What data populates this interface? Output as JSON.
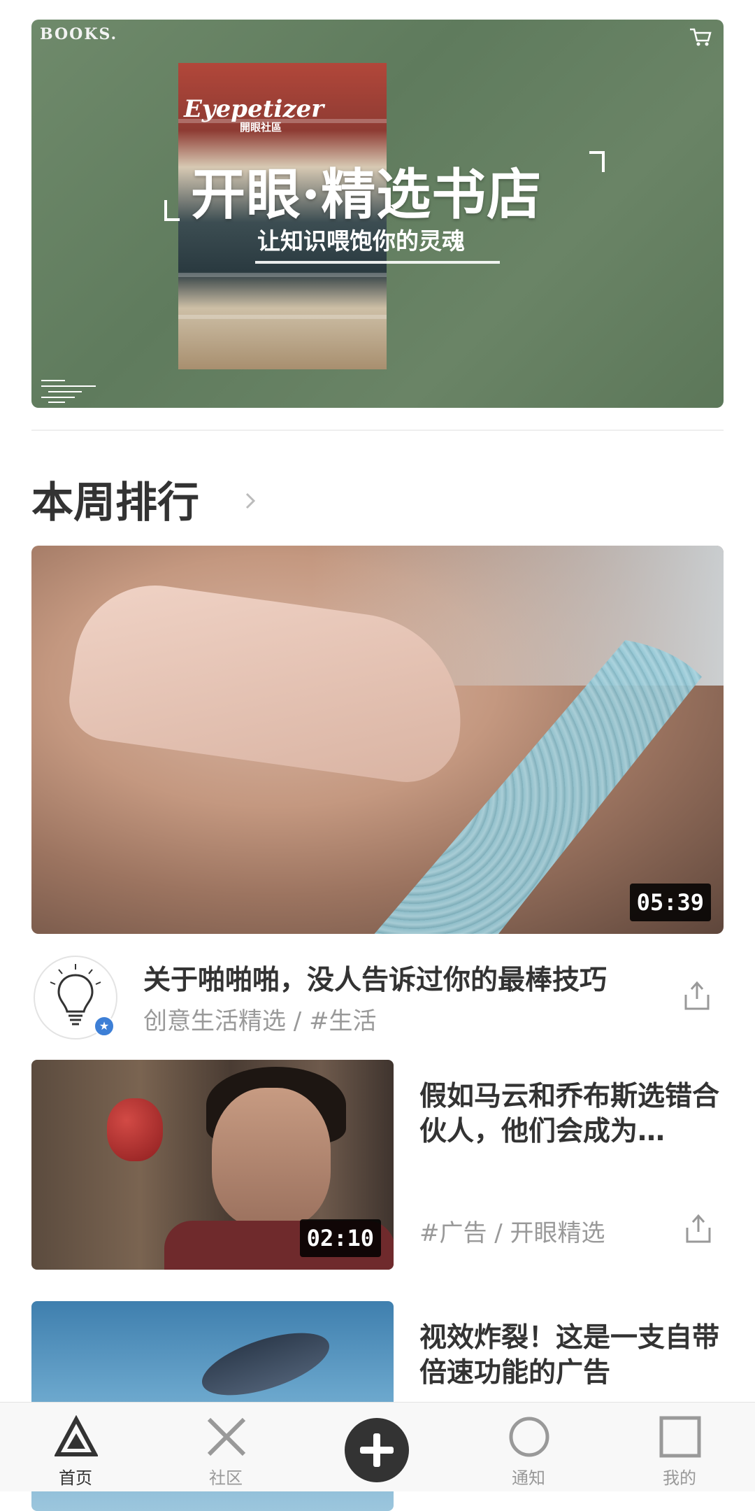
{
  "banner": {
    "corner_label": "BOOKS.",
    "logo": "Eyepetizer",
    "logo_sub": "開眼社區",
    "headline": "开眼·精选书店",
    "subline": "让知识喂饱你的灵魂"
  },
  "section": {
    "title": "本周排行"
  },
  "hero_video": {
    "duration": "05:39",
    "title": "关于啪啪啪，没人告诉过你的最棒技巧",
    "subtitle": "创意生活精选  /  #生活"
  },
  "feed": [
    {
      "title": "假如马云和乔布斯选错合伙人，他们会成为…",
      "tags": "#广告  /  开眼精选",
      "duration": "02:10"
    },
    {
      "title": "视效炸裂！这是一支自带倍速功能的广告",
      "tags": "",
      "duration": ""
    }
  ],
  "bottom_nav": {
    "items": [
      {
        "label": "首页",
        "icon": "triangle-icon",
        "active": true
      },
      {
        "label": "社区",
        "icon": "cross-icon",
        "active": false
      },
      {
        "label": "",
        "icon": "add-icon",
        "active": false
      },
      {
        "label": "通知",
        "icon": "circle-icon",
        "active": false
      },
      {
        "label": "我的",
        "icon": "square-icon",
        "active": false
      }
    ]
  },
  "colors": {
    "banner_bg": "#6a8466",
    "text_primary": "#333333",
    "text_secondary": "#999999",
    "badge_blue": "#3d7fd6"
  }
}
